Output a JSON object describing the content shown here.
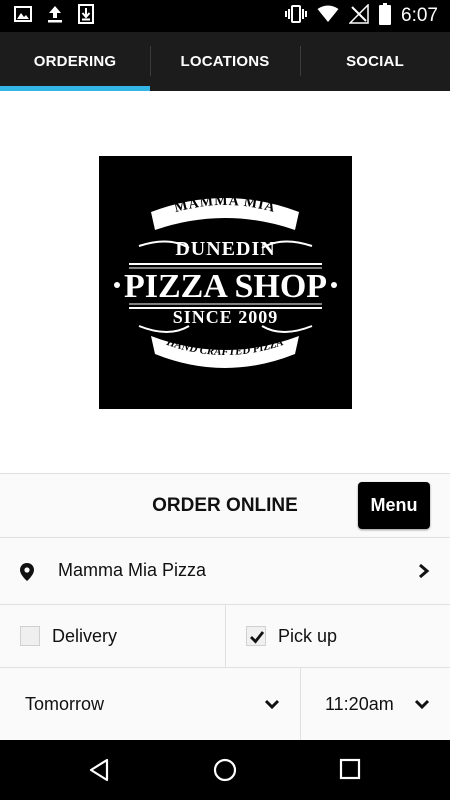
{
  "status_bar": {
    "time": "6:07"
  },
  "tabs": [
    {
      "label": "ORDERING",
      "active": true
    },
    {
      "label": "LOCATIONS",
      "active": false
    },
    {
      "label": "SOCIAL",
      "active": false
    }
  ],
  "logo": {
    "line1": "MAMMA MIA",
    "line2": "DUNEDIN",
    "line3": "PIZZA SHOP",
    "line4": "SINCE 2009",
    "line5": "HAND CRAFTED PIZZA"
  },
  "order": {
    "title": "ORDER ONLINE",
    "menu_label": "Menu"
  },
  "location": {
    "name": "Mamma Mia Pizza"
  },
  "mode": {
    "delivery_label": "Delivery",
    "delivery_checked": false,
    "pickup_label": "Pick up",
    "pickup_checked": true
  },
  "schedule": {
    "day": "Tomorrow",
    "time": "11:20am"
  },
  "colors": {
    "accent": "#33b5e5",
    "tabbar": "#1c1c1c"
  }
}
